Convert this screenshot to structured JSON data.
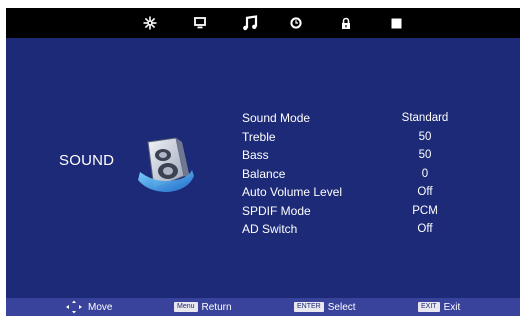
{
  "colors": {
    "background": "#1d2a78",
    "top_bar": "#000000",
    "bottom_bar": "#39439b",
    "text": "#ffffff"
  },
  "tabs": [
    {
      "icon": "picture-settings-icon",
      "active": false
    },
    {
      "icon": "monitor-icon",
      "active": false
    },
    {
      "icon": "music-note-icon",
      "active": true
    },
    {
      "icon": "clock-icon",
      "active": false
    },
    {
      "icon": "lock-icon",
      "active": false
    },
    {
      "icon": "square-icon",
      "active": false
    }
  ],
  "section": {
    "title": "SOUND",
    "icon": "speaker-icon"
  },
  "menu": [
    {
      "label": "Sound Mode",
      "value": "Standard"
    },
    {
      "label": "Treble",
      "value": "50"
    },
    {
      "label": "Bass",
      "value": "50"
    },
    {
      "label": "Balance",
      "value": "0"
    },
    {
      "label": "Auto Volume Level",
      "value": "Off"
    },
    {
      "label": "SPDIF Mode",
      "value": "PCM"
    },
    {
      "label": "AD Switch",
      "value": "Off"
    }
  ],
  "footer": {
    "move": {
      "label": "Move",
      "icon": "dpad-icon"
    },
    "return": {
      "key": "Menu",
      "label": "Return"
    },
    "select": {
      "key": "ENTER",
      "label": "Select"
    },
    "exit": {
      "key": "EXIT",
      "label": "Exit"
    }
  }
}
